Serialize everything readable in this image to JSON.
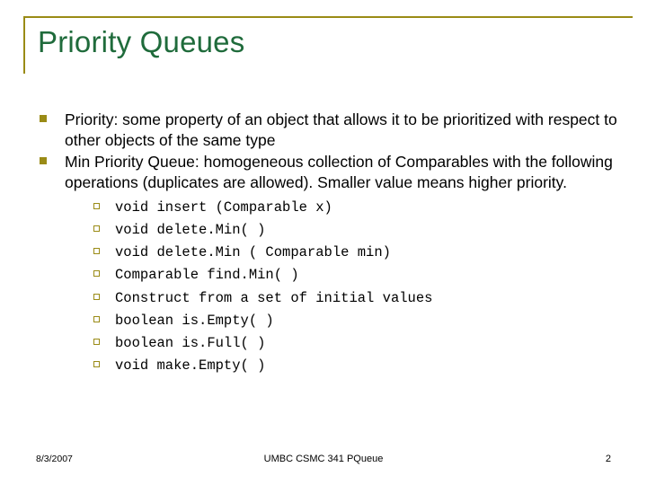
{
  "slide": {
    "title": "Priority Queues",
    "bullets": [
      {
        "text": "Priority: some property of an object that allows it to be prioritized with respect to other objects of the same type",
        "sub": []
      },
      {
        "text": "Min Priority Queue: homogeneous collection of Comparables with the following operations (duplicates are allowed). Smaller value means higher priority.",
        "sub": [
          "void insert (Comparable x)",
          "void delete.Min( )",
          "void delete.Min ( Comparable min)",
          "Comparable find.Min( )",
          "Construct from a set of initial values",
          "boolean is.Empty( )",
          "boolean is.Full( )",
          "void make.Empty( )"
        ]
      }
    ],
    "footer": {
      "date": "8/3/2007",
      "center": "UMBC CSMC 341 PQueue",
      "page": "2"
    },
    "colors": {
      "title": "#1f6b3b",
      "accent": "#9a8b16",
      "text": "#000000"
    }
  }
}
